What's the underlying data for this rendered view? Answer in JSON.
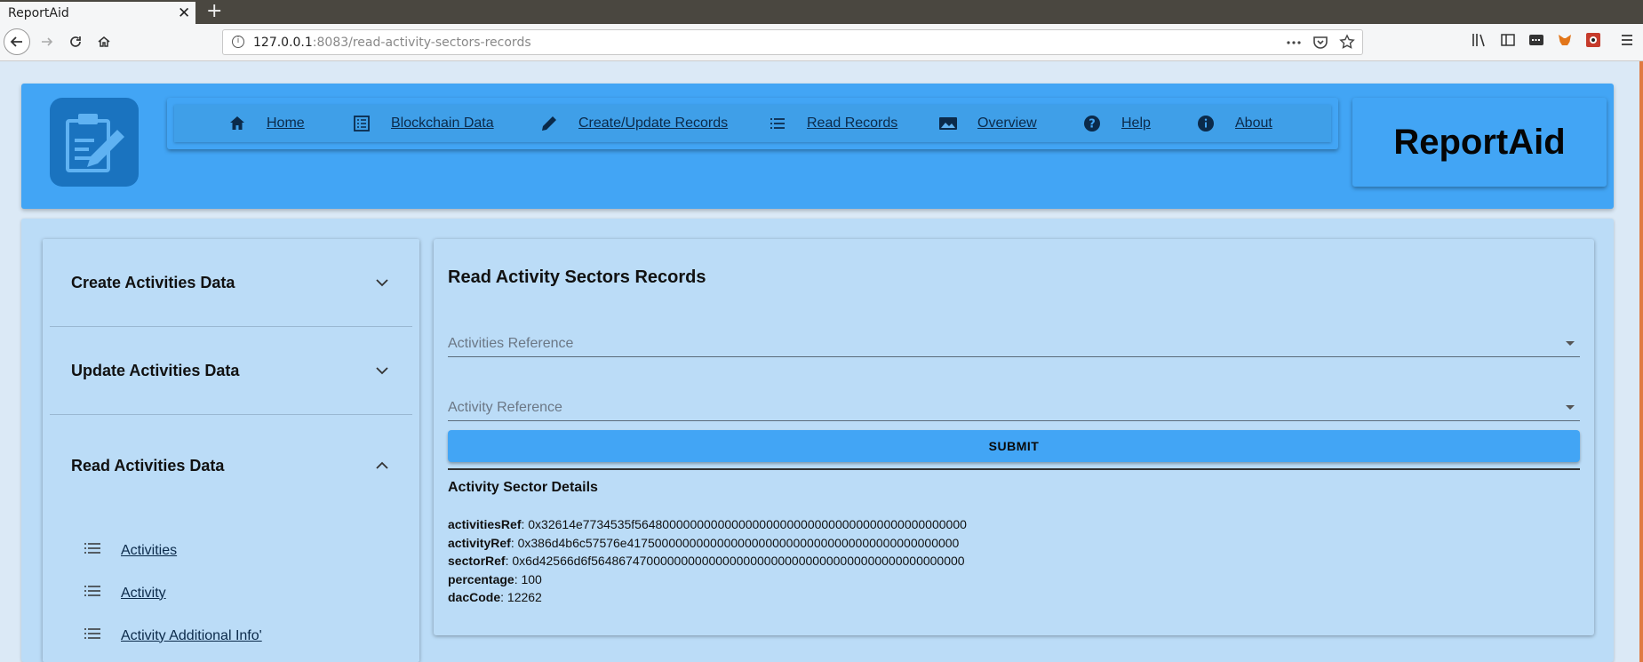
{
  "browser": {
    "tab_title": "ReportAid",
    "url_host": "127.0.0.1",
    "url_rest": ":8083/read-activity-sectors-records"
  },
  "brand": {
    "name": "ReportAid"
  },
  "menu": [
    {
      "label": "Home",
      "icon": "home-icon"
    },
    {
      "label": "Blockchain Data",
      "icon": "list-box-icon"
    },
    {
      "label": "Create/Update Records",
      "icon": "pencil-icon"
    },
    {
      "label": "Read Records",
      "icon": "list-icon"
    },
    {
      "label": "Overview",
      "icon": "image-icon"
    },
    {
      "label": "Help",
      "icon": "help-icon"
    },
    {
      "label": "About",
      "icon": "info-icon"
    }
  ],
  "sidebar": {
    "sections": [
      {
        "title": "Create Activities Data",
        "expanded": false
      },
      {
        "title": "Update Activities Data",
        "expanded": false
      },
      {
        "title": "Read Activities Data",
        "expanded": true
      }
    ],
    "read_items": [
      "Activities",
      "Activity",
      "Activity Additional Info'"
    ]
  },
  "main": {
    "title": "Read Activity Sectors Records",
    "field1_label": "Activities Reference",
    "field2_label": "Activity Reference",
    "submit_label": "SUBMIT",
    "details_title": "Activity Sector Details",
    "details": [
      {
        "key": "activitiesRef",
        "value": ": 0x32614e7734535f564800000000000000000000000000000000000000000000"
      },
      {
        "key": "activityRef",
        "value": ": 0x386d4b6c57576e417500000000000000000000000000000000000000000000"
      },
      {
        "key": "sectorRef",
        "value": ": 0x6d42566d6f564867470000000000000000000000000000000000000000000000"
      },
      {
        "key": "percentage",
        "value": ": 100"
      },
      {
        "key": "dacCode",
        "value": ": 12262"
      }
    ]
  },
  "colors": {
    "header_bg": "#42a5f5",
    "content_bg": "#bbdcf7",
    "page_bg": "#dbe9f6",
    "logo_bg": "#1a73bf"
  }
}
